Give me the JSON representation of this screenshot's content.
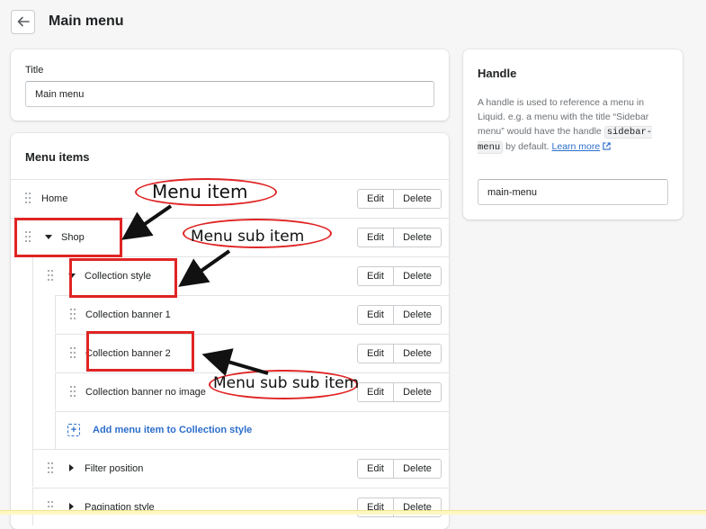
{
  "header": {
    "title": "Main menu",
    "back_icon": "arrow-left-icon"
  },
  "title_card": {
    "label": "Title",
    "value": "Main menu"
  },
  "menu_items": {
    "heading": "Menu items",
    "buttons": {
      "edit": "Edit",
      "delete": "Delete"
    },
    "rows": [
      {
        "label": "Home"
      },
      {
        "label": "Shop"
      },
      {
        "label": "Collection style"
      },
      {
        "label": "Collection banner 1"
      },
      {
        "label": "Collection banner 2"
      },
      {
        "label": "Collection banner no image"
      },
      {
        "label": "Filter position"
      },
      {
        "label": "Pagination style"
      }
    ],
    "add_label": "Add menu item to Collection style"
  },
  "handle_card": {
    "title": "Handle",
    "help_before": "A handle is used to reference a menu in Liquid. e.g. a menu with the title “Sidebar menu” would have the handle",
    "help_code": "sidebar-menu",
    "help_after": "by default.",
    "learn_more": "Learn more",
    "value": "main-menu"
  },
  "annotations": {
    "menu_item": "Menu item",
    "menu_sub_item": "Menu sub item",
    "menu_sub_sub_item": "Menu sub sub item",
    "accent_color": "#e02424"
  }
}
